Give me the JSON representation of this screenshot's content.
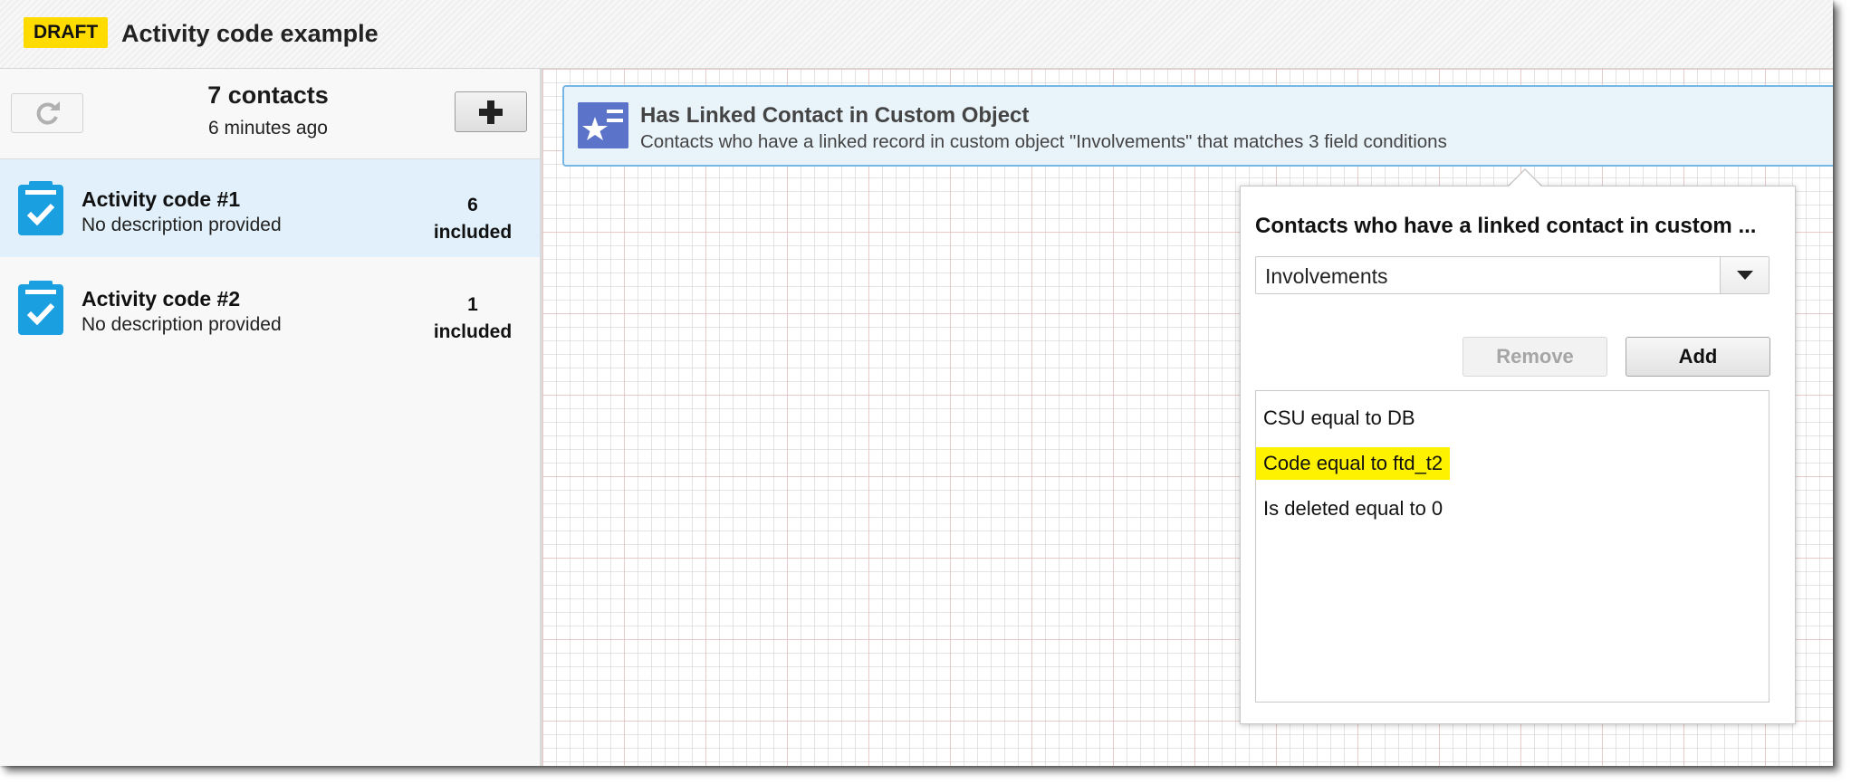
{
  "header": {
    "badge": "DRAFT",
    "title": "Activity code example"
  },
  "sidebar": {
    "contact_count": "7 contacts",
    "updated": "6 minutes ago",
    "items": [
      {
        "title": "Activity code #1",
        "description": "No description provided",
        "count": "6",
        "count_label": "included",
        "selected": true
      },
      {
        "title": "Activity code #2",
        "description": "No description provided",
        "count": "1",
        "count_label": "included",
        "selected": false
      }
    ]
  },
  "criteria": {
    "title": "Has Linked Contact in Custom Object",
    "description": "Contacts who have a linked record in custom object \"Involvements\" that matches 3 field conditions"
  },
  "popover": {
    "title": "Contacts who have a linked contact in custom ...",
    "object_select": "Involvements",
    "remove_label": "Remove",
    "add_label": "Add",
    "conditions": [
      {
        "text": "CSU equal to DB",
        "highlighted": false
      },
      {
        "text": "Code equal to ftd_t2",
        "highlighted": true
      },
      {
        "text": "Is deleted equal to 0",
        "highlighted": false
      }
    ]
  },
  "colors": {
    "draft_badge": "#ffdb00",
    "selected_row": "#e1f0fa",
    "icon_blue": "#1a9fe0",
    "criteria_icon": "#5b73c8",
    "highlight": "#fff200"
  },
  "icons": {
    "refresh": "refresh-icon",
    "add": "plus-icon",
    "segment_item": "clipboard-check-icon",
    "criteria": "star-list-icon",
    "dropdown": "caret-down-icon"
  }
}
